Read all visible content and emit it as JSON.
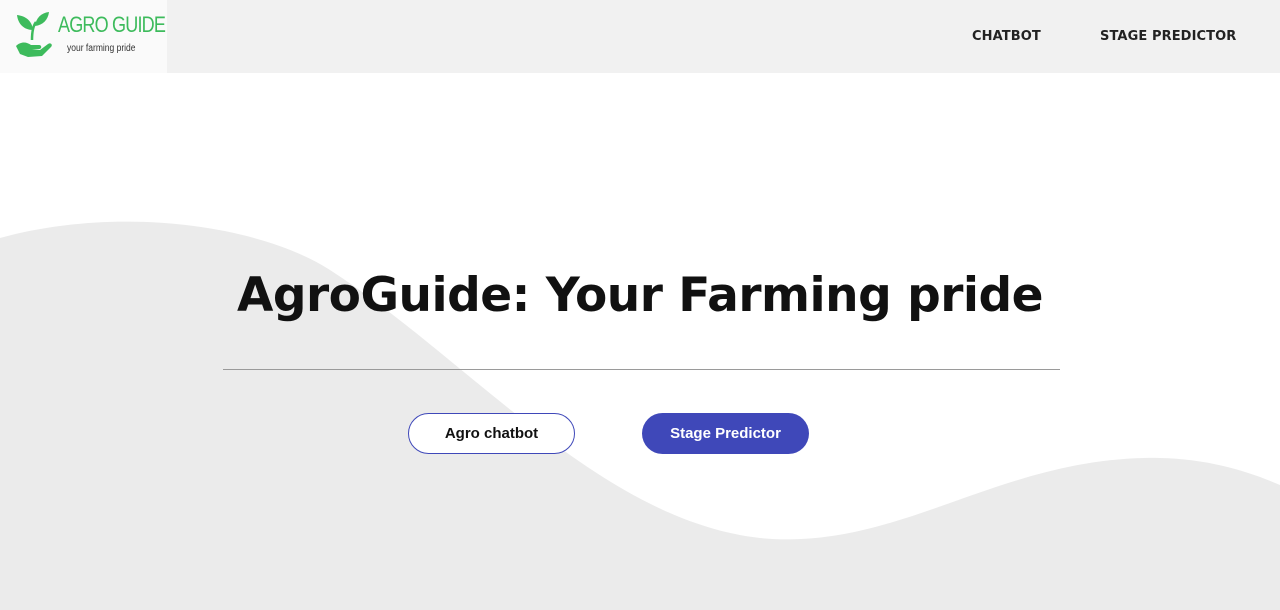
{
  "header": {
    "logo": {
      "title": "AGRO GUIDE",
      "subtitle": "your farming pride"
    },
    "nav": [
      {
        "label": "CHATBOT"
      },
      {
        "label": "STAGE PREDICTOR"
      }
    ]
  },
  "hero": {
    "title": "AgroGuide: Your Farming pride",
    "buttons": {
      "chatbot_label": "Agro chatbot",
      "stage_label": "Stage Predictor"
    }
  },
  "colors": {
    "accent": "#3f48b9",
    "logo_green": "#3dbb5c",
    "navbar_bg": "#f1f1f1",
    "wave": "#ebebeb"
  }
}
